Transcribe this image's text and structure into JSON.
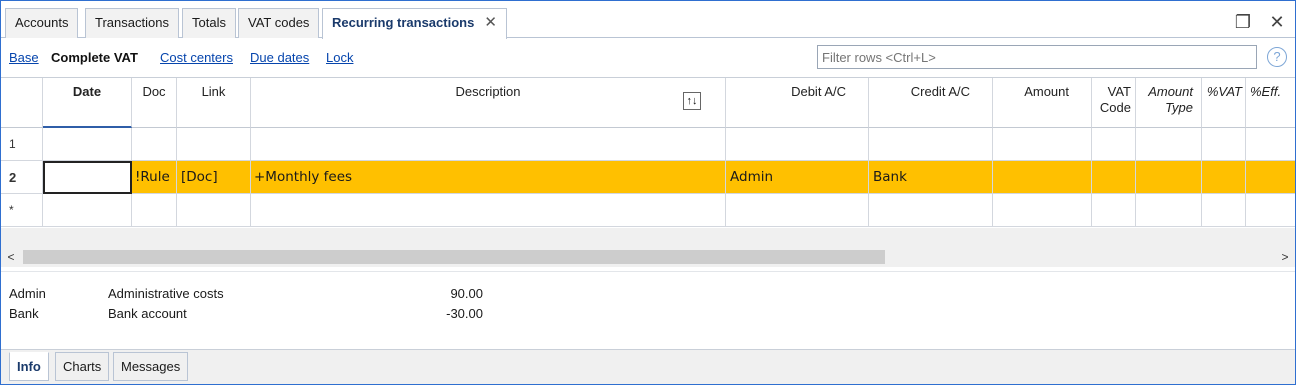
{
  "tabs": [
    {
      "label": "Accounts"
    },
    {
      "label": "Transactions"
    },
    {
      "label": "Totals"
    },
    {
      "label": "VAT codes"
    },
    {
      "label": "Recurring transactions",
      "active": true,
      "close": "✕"
    }
  ],
  "window_controls": {
    "restore": "❐",
    "close": "✕"
  },
  "views": [
    {
      "label": "Base"
    },
    {
      "label": "Complete VAT",
      "current": true
    },
    {
      "label": "Cost centers"
    },
    {
      "label": "Due dates"
    },
    {
      "label": "Lock"
    }
  ],
  "filter": {
    "placeholder": "Filter rows <Ctrl+L>",
    "value": ""
  },
  "help_icon": "?",
  "columns": [
    {
      "label": "Date"
    },
    {
      "label": "Doc"
    },
    {
      "label": "Link"
    },
    {
      "label": "Description"
    },
    {
      "label": "Debit A/C"
    },
    {
      "label": "Credit A/C"
    },
    {
      "label": "Amount"
    },
    {
      "label": "VAT Code"
    },
    {
      "label": "Amount Type"
    },
    {
      "label": "%VAT"
    },
    {
      "label": "%Eff."
    }
  ],
  "sort_icon": "↑↓",
  "rows": [
    {
      "num": "1",
      "date": "",
      "doc": "",
      "link": "",
      "description": "",
      "debit": "",
      "credit": "",
      "amount": ""
    },
    {
      "num": "2",
      "date": "",
      "doc": "!Rule",
      "link": "[Doc]",
      "description": "+Monthly fees",
      "debit": "Admin",
      "credit": "Bank",
      "amount": "",
      "selected": true
    },
    {
      "num": "*",
      "date": "",
      "doc": "",
      "link": "",
      "description": "",
      "debit": "",
      "credit": "",
      "amount": ""
    }
  ],
  "scroll": {
    "left": "<",
    "right": ">"
  },
  "info_rows": [
    {
      "account": "Admin",
      "description": "Administrative costs",
      "amount": "90.00"
    },
    {
      "account": "Bank",
      "description": "Bank account",
      "amount": "-30.00"
    }
  ],
  "bottom_tabs": [
    {
      "label": "Info",
      "active": true
    },
    {
      "label": "Charts"
    },
    {
      "label": "Messages"
    }
  ],
  "colors": {
    "selected_row": "#ffc000",
    "accent": "#2f6fd0",
    "link": "#0645ad"
  }
}
